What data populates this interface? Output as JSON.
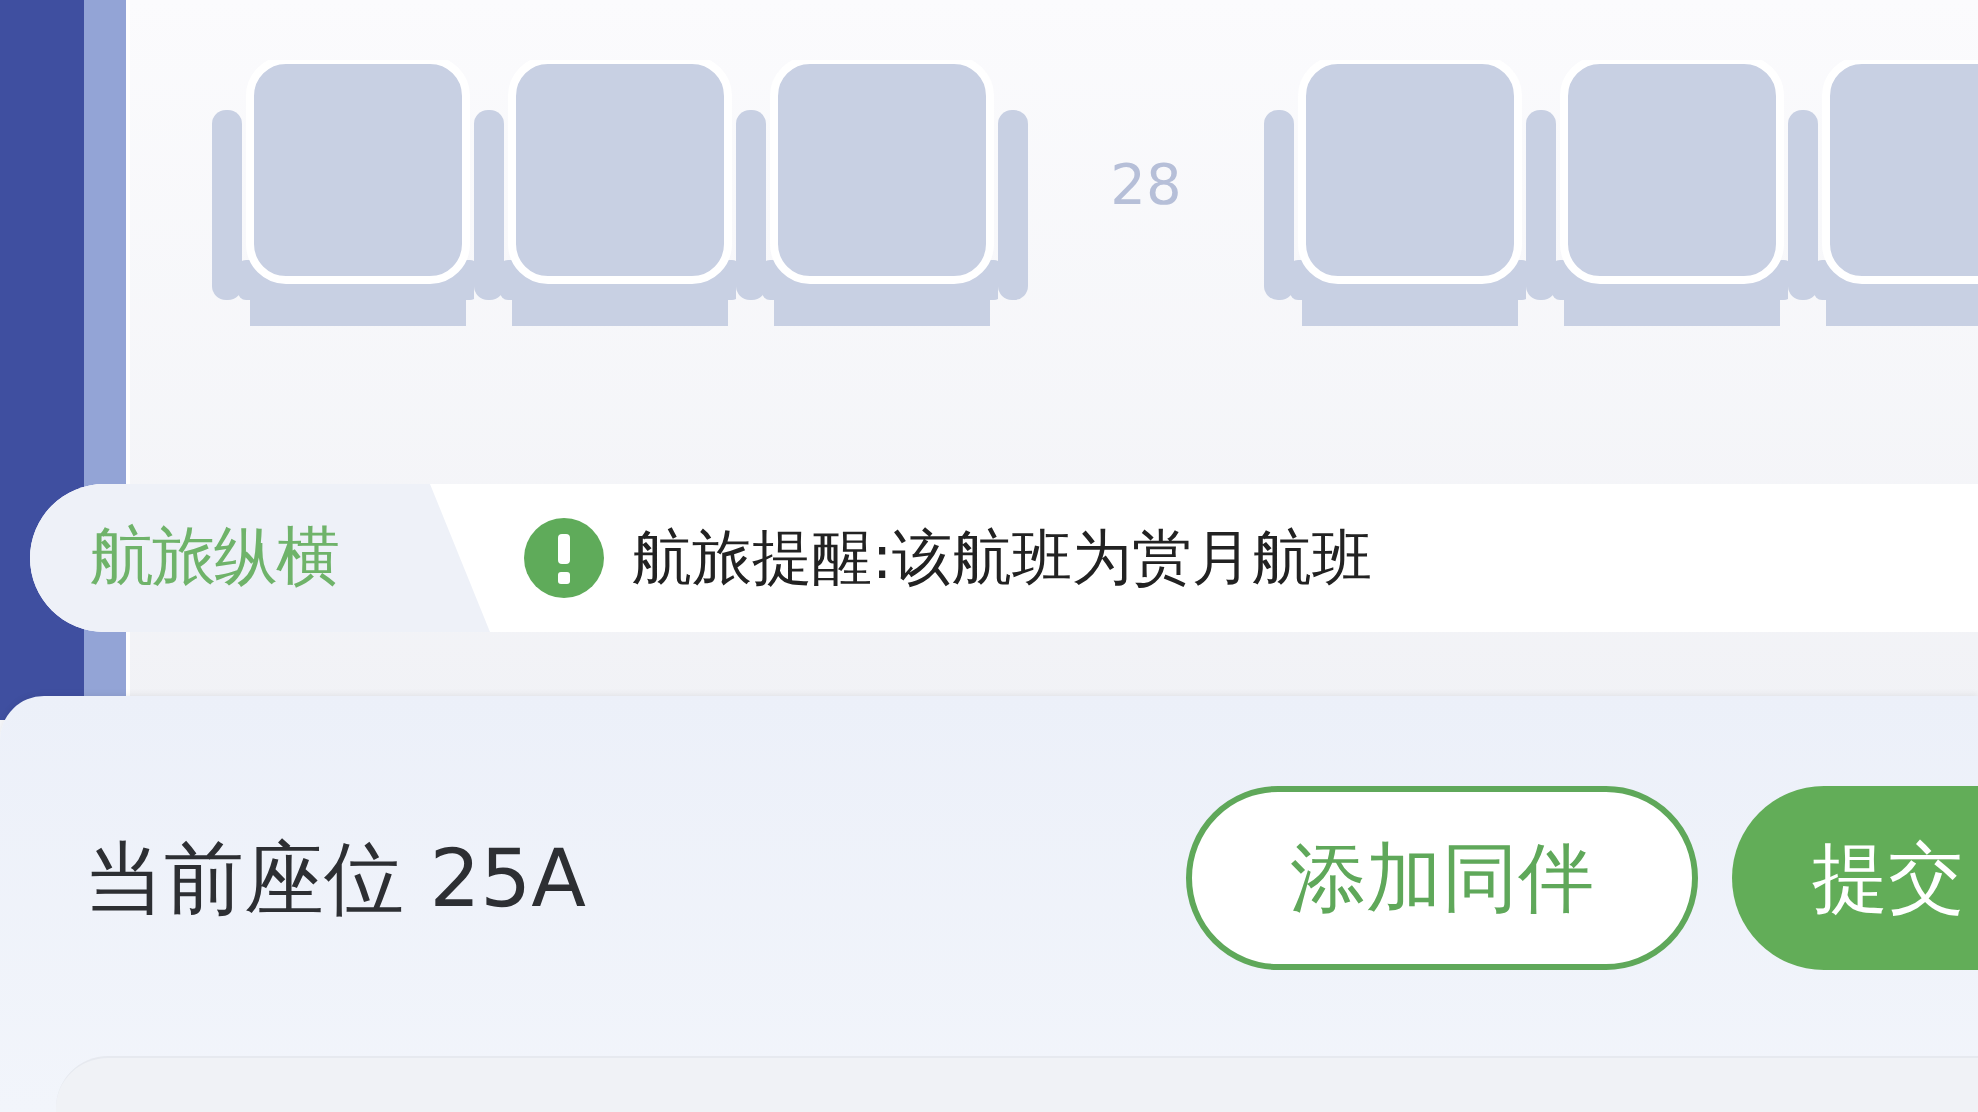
{
  "seat_rows": [
    {
      "row_number": "28",
      "groups": [
        {
          "seats": [
            {
              "selected": false
            },
            {
              "selected": false
            },
            {
              "selected": false
            }
          ]
        },
        {
          "seats": [
            {
              "selected": false
            },
            {
              "selected": false
            },
            {
              "selected": false
            }
          ]
        }
      ]
    }
  ],
  "notice": {
    "brand": "航旅纵横",
    "text": "航旅提醒:该航班为赏月航班"
  },
  "panel": {
    "current_seat": "当前座位 25A",
    "buttons": [
      {
        "label": "添加同伴",
        "kind": "outline"
      },
      {
        "label": "提交",
        "kind": "filled"
      }
    ]
  }
}
